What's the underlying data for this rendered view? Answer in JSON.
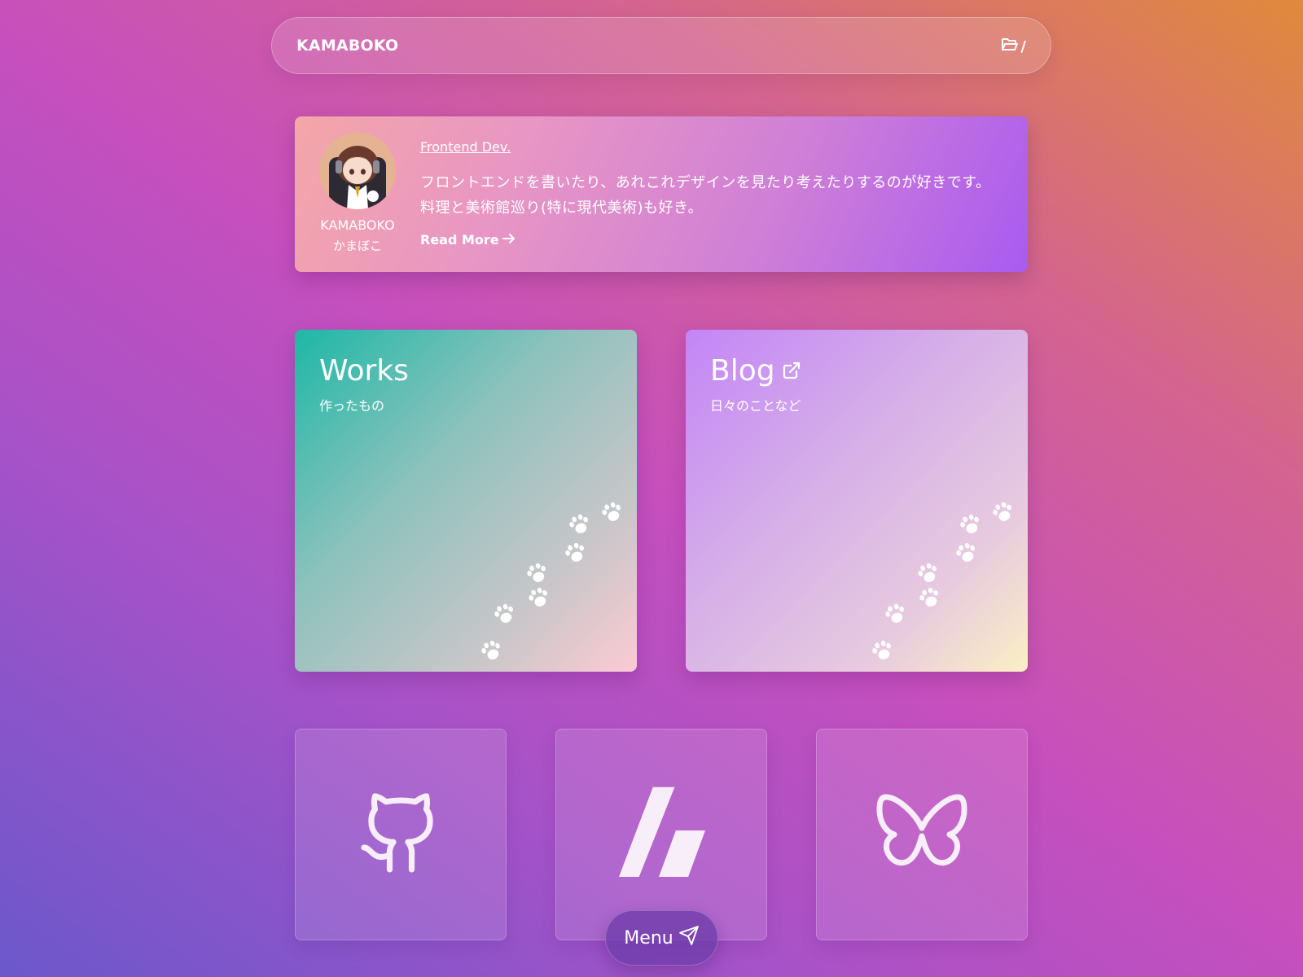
{
  "header": {
    "brand": "KAMABOKO",
    "path_label": "/",
    "folder_icon": "folder-open-icon"
  },
  "profile": {
    "name_en": "KAMABOKO",
    "name_jp": "かまぼこ",
    "role": "Frontend Dev.",
    "bio": "フロントエンドを書いたり、あれこれデザインを見たり考えたりするのが好きです。料理と美術館巡り(特に現代美術)も好き。",
    "read_more": "Read More",
    "arrow_icon": "arrow-right-icon"
  },
  "tiles": {
    "works": {
      "title": "Works",
      "subtitle": "作ったもの",
      "decoration_icon": "paw-prints-icon"
    },
    "blog": {
      "title": "Blog",
      "subtitle": "日々のことなど",
      "external_icon": "external-link-icon",
      "decoration_icon": "paw-prints-icon"
    }
  },
  "social": [
    {
      "icon": "github-icon"
    },
    {
      "icon": "zenn-icon"
    },
    {
      "icon": "bluesky-icon"
    }
  ],
  "menu": {
    "label": "Menu",
    "icon": "send-icon"
  },
  "colors": {
    "background_start": "#6b58cb",
    "background_end": "#e08a3c",
    "profile_start": "#f4a6a8",
    "profile_end": "#a95bf0",
    "works_start": "#1db8a6",
    "works_end": "#fccbd3",
    "blog_start": "#c385f7",
    "blog_end": "#fbefc5",
    "menu_button": "#6e3caa"
  }
}
